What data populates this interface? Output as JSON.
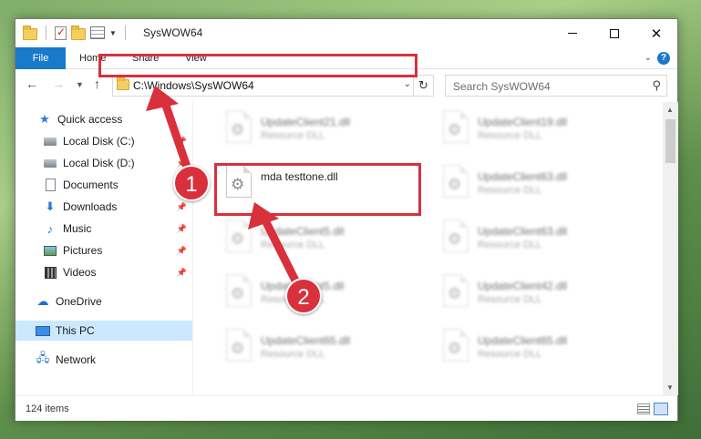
{
  "window": {
    "title": "SysWOW64",
    "minimize_label": "",
    "maximize_label": "",
    "close_label": "✕"
  },
  "ribbon": {
    "tabs": [
      "File",
      "Home",
      "Share",
      "View"
    ],
    "accent": "#1979ca"
  },
  "nav": {
    "address": "C:\\Windows\\SysWOW64",
    "search_placeholder": "Search SysWOW64"
  },
  "sidebar": {
    "items": [
      {
        "label": "Quick access",
        "icon": "star-icon",
        "pinned": false
      },
      {
        "label": "Local Disk (C:)",
        "icon": "disk-icon",
        "pinned": true
      },
      {
        "label": "Local Disk (D:)",
        "icon": "disk-icon",
        "pinned": true
      },
      {
        "label": "Documents",
        "icon": "document-icon",
        "pinned": true
      },
      {
        "label": "Downloads",
        "icon": "download-icon",
        "pinned": true
      },
      {
        "label": "Music",
        "icon": "music-icon",
        "pinned": true
      },
      {
        "label": "Pictures",
        "icon": "pictures-icon",
        "pinned": true
      },
      {
        "label": "Videos",
        "icon": "videos-icon",
        "pinned": true
      },
      {
        "label": "OneDrive",
        "icon": "cloud-icon",
        "pinned": false
      },
      {
        "label": "This PC",
        "icon": "computer-icon",
        "pinned": false,
        "selected": true
      },
      {
        "label": "Network",
        "icon": "network-icon",
        "pinned": false
      }
    ]
  },
  "files": [
    {
      "name": "UpdateClient21.dll",
      "type": "Resource DLL",
      "blurred": true
    },
    {
      "name": "UpdateClient19.dll",
      "type": "Resource DLL",
      "blurred": true
    },
    {
      "name": "mda testtone.dll",
      "type": "",
      "blurred": false,
      "highlighted": true
    },
    {
      "name": "UpdateClient63.dll",
      "type": "Resource DLL",
      "blurred": true
    },
    {
      "name": "UpdateClient5.dll",
      "type": "Resource DLL",
      "blurred": true
    },
    {
      "name": "UpdateClient63.dll",
      "type": "Resource DLL",
      "blurred": true
    },
    {
      "name": "UpdateClient5.dll",
      "type": "Resource DLL",
      "blurred": true
    },
    {
      "name": "UpdateClient42.dll",
      "type": "Resource DLL",
      "blurred": true
    },
    {
      "name": "UpdateClient65.dll",
      "type": "Resource DLL",
      "blurred": true
    },
    {
      "name": "UpdateClient65.dll",
      "type": "Resource DLL",
      "blurred": true
    }
  ],
  "status": {
    "item_count": "124 items"
  },
  "annotations": {
    "step1": "1",
    "step2": "2",
    "color": "#d8313c"
  }
}
